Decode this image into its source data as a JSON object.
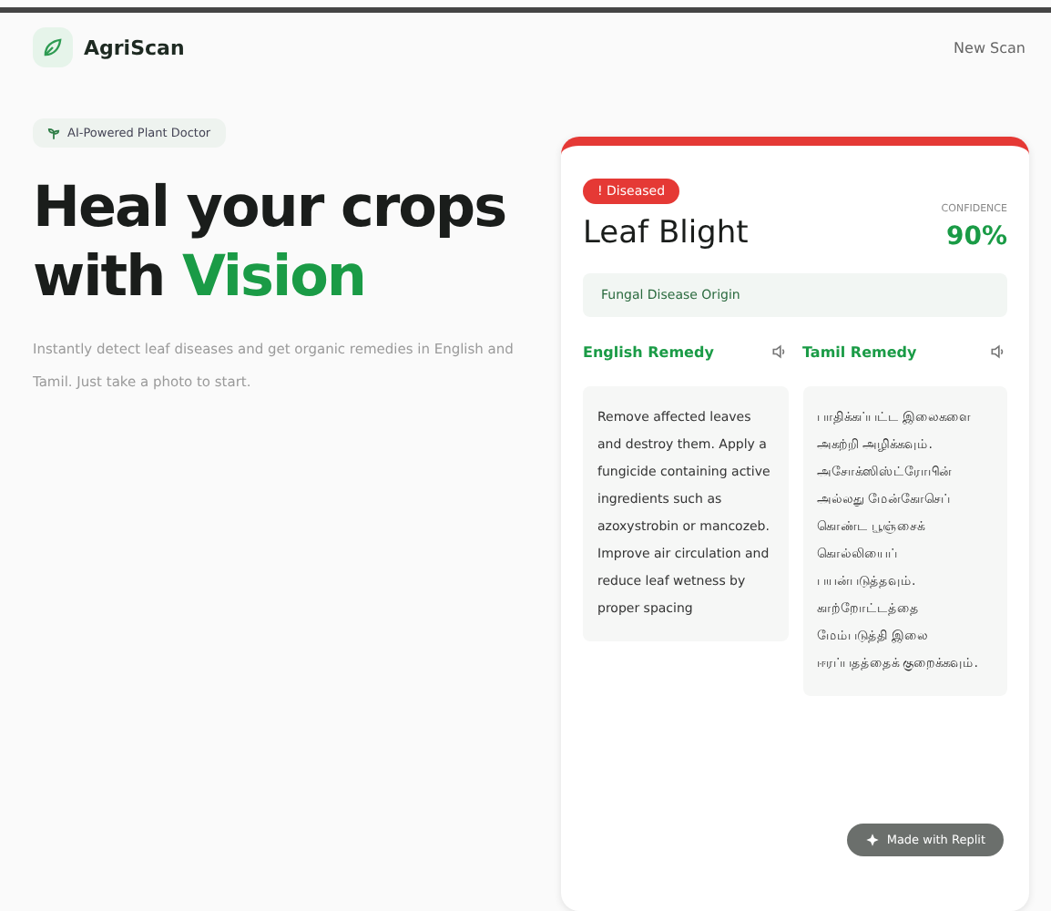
{
  "header": {
    "brand": "AgriScan",
    "action": "New Scan"
  },
  "hero": {
    "tag": "AI-Powered Plant Doctor",
    "title_line1": "Heal your crops",
    "title_prefix": "with",
    "title_highlight": "Vision",
    "description": "Instantly detect leaf diseases and get organic remedies in English and Tamil. Just take a photo to start."
  },
  "result": {
    "status": "! Diseased",
    "disease": "Leaf Blight",
    "confidence_label": "CONFIDENCE",
    "confidence": "90%",
    "origin": "Fungal Disease Origin",
    "remedies": [
      {
        "title": "English Remedy",
        "text": "Remove affected leaves and destroy them. Apply a fungicide containing active ingredients such as azoxystrobin or mancozeb. Improve air circulation and reduce leaf wetness by proper spacing"
      },
      {
        "title": "Tamil Remedy",
        "text": "பாதிக்கப்பட்ட இலைகளை அகற்றி அழிக்கவும். அசோக்ஸிஸ்ட்ரோபின் அல்லது மேன்கோசெப் கொண்ட பூஞ்சைக் கொல்லியைப் பயன்படுத்தவும். காற்றோட்டத்தை மேம்படுத்தி இலை ஈரப்பதத்தைக் குறைக்கவும்."
      }
    ]
  },
  "floating_badge": "Made with Replit"
}
